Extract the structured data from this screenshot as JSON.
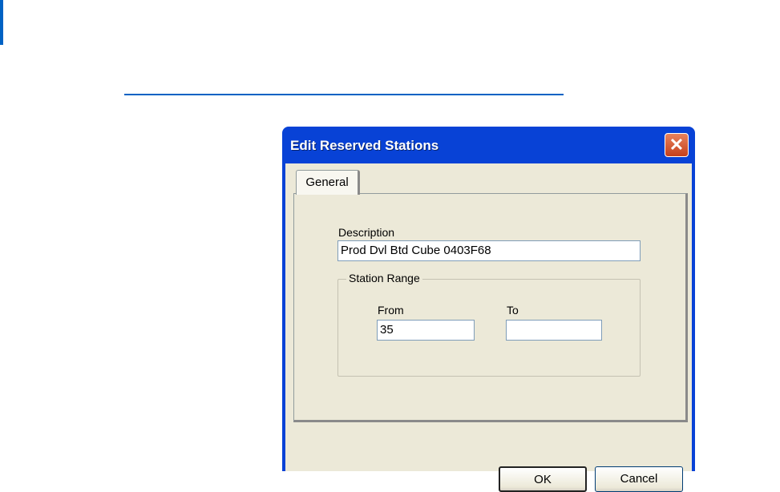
{
  "dialog": {
    "title": "Edit Reserved Stations",
    "close_icon": "close-icon"
  },
  "tabs": [
    {
      "label": "General"
    }
  ],
  "form": {
    "description_label": "Description",
    "description_value": "Prod Dvl Btd Cube 0403F68",
    "station_range_label": "Station Range",
    "from_label": "From",
    "from_value": "35",
    "to_label": "To",
    "to_value": ""
  },
  "buttons": {
    "ok": "OK",
    "cancel": "Cancel"
  },
  "colors": {
    "accent": "#0062c4",
    "titlebar": "#0842d6",
    "dialog_bg": "#ece9d8"
  }
}
